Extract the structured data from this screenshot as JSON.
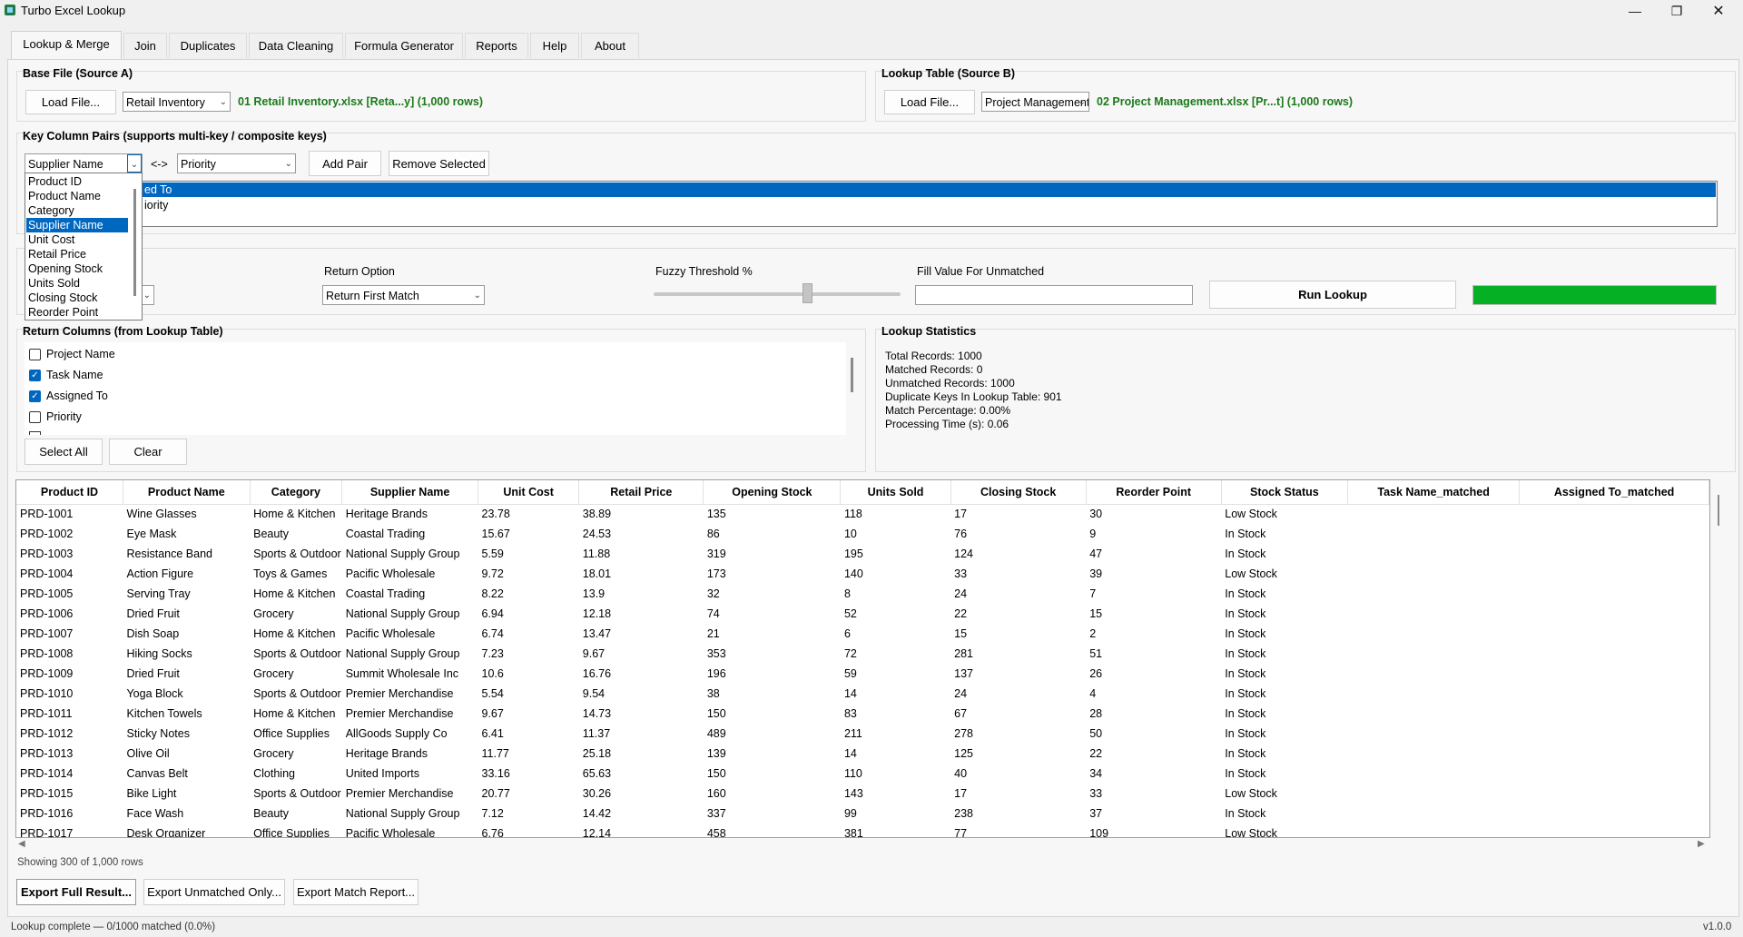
{
  "window": {
    "title": "Turbo Excel Lookup"
  },
  "tabs": [
    {
      "label": "Lookup & Merge"
    },
    {
      "label": "Join"
    },
    {
      "label": "Duplicates"
    },
    {
      "label": "Data Cleaning"
    },
    {
      "label": "Formula Generator"
    },
    {
      "label": "Reports"
    },
    {
      "label": "Help"
    },
    {
      "label": "About"
    }
  ],
  "base_file": {
    "title": "Base File (Source A)",
    "load_label": "Load File...",
    "sheet": "Retail Inventory",
    "info": "01 Retail Inventory.xlsx  [Reta...y]  (1,000 rows)"
  },
  "lookup_table": {
    "title": "Lookup Table (Source B)",
    "load_label": "Load File...",
    "sheet": "Project Management",
    "info": "02 Project Management.xlsx  [Pr...t]  (1,000 rows)"
  },
  "key_pairs": {
    "title": "Key Column Pairs  (supports multi-key / composite keys)",
    "left_value": "Supplier Name",
    "arrow": "<->",
    "right_value": "Priority",
    "add_label": "Add Pair",
    "remove_label": "Remove Selected",
    "list_items": [
      "ed To",
      "iority"
    ]
  },
  "dropdown_options": [
    "Product ID",
    "Product Name",
    "Category",
    "Supplier Name",
    "Unit Cost",
    "Retail Price",
    "Opening Stock",
    "Units Sold",
    "Closing Stock",
    "Reorder Point"
  ],
  "options": {
    "return_option_label": "Return Option",
    "return_option_value": "Return First Match",
    "fuzzy_label": "Fuzzy Threshold %",
    "fuzzy_value": 0.62,
    "fill_label": "Fill Value For Unmatched",
    "fill_value": "",
    "run_label": "Run Lookup",
    "progress": 1.0
  },
  "return_columns": {
    "title": "Return Columns (from Lookup Table)",
    "items": [
      {
        "label": "Project Name",
        "checked": false
      },
      {
        "label": "Task Name",
        "checked": true
      },
      {
        "label": "Assigned To",
        "checked": true
      },
      {
        "label": "Priority",
        "checked": false
      }
    ],
    "select_all_label": "Select All",
    "clear_label": "Clear"
  },
  "stats": {
    "title": "Lookup Statistics",
    "lines": [
      "Total Records: 1000",
      "Matched Records: 0",
      "Unmatched Records: 1000",
      "Duplicate Keys In Lookup Table: 901",
      "Match Percentage: 0.00%",
      "Processing Time (s): 0.06"
    ]
  },
  "grid": {
    "columns": [
      "Product ID",
      "Product Name",
      "Category",
      "Supplier Name",
      "Unit Cost",
      "Retail Price",
      "Opening Stock",
      "Units Sold",
      "Closing Stock",
      "Reorder Point",
      "Stock Status",
      "Task Name_matched",
      "Assigned To_matched"
    ],
    "rows": [
      [
        "PRD-1001",
        "Wine Glasses",
        "Home & Kitchen",
        "Heritage Brands",
        "23.78",
        "38.89",
        "135",
        "118",
        "17",
        "30",
        "Low Stock",
        "",
        ""
      ],
      [
        "PRD-1002",
        "Eye Mask",
        "Beauty",
        "Coastal Trading",
        "15.67",
        "24.53",
        "86",
        "10",
        "76",
        "9",
        "In Stock",
        "",
        ""
      ],
      [
        "PRD-1003",
        "Resistance Band",
        "Sports & Outdoor",
        "National Supply Group",
        "5.59",
        "11.88",
        "319",
        "195",
        "124",
        "47",
        "In Stock",
        "",
        ""
      ],
      [
        "PRD-1004",
        "Action Figure",
        "Toys & Games",
        "Pacific Wholesale",
        "9.72",
        "18.01",
        "173",
        "140",
        "33",
        "39",
        "Low Stock",
        "",
        ""
      ],
      [
        "PRD-1005",
        "Serving Tray",
        "Home & Kitchen",
        "Coastal Trading",
        "8.22",
        "13.9",
        "32",
        "8",
        "24",
        "7",
        "In Stock",
        "",
        ""
      ],
      [
        "PRD-1006",
        "Dried Fruit",
        "Grocery",
        "National Supply Group",
        "6.94",
        "12.18",
        "74",
        "52",
        "22",
        "15",
        "In Stock",
        "",
        ""
      ],
      [
        "PRD-1007",
        "Dish Soap",
        "Home & Kitchen",
        "Pacific Wholesale",
        "6.74",
        "13.47",
        "21",
        "6",
        "15",
        "2",
        "In Stock",
        "",
        ""
      ],
      [
        "PRD-1008",
        "Hiking Socks",
        "Sports & Outdoor",
        "National Supply Group",
        "7.23",
        "9.67",
        "353",
        "72",
        "281",
        "51",
        "In Stock",
        "",
        ""
      ],
      [
        "PRD-1009",
        "Dried Fruit",
        "Grocery",
        "Summit Wholesale Inc",
        "10.6",
        "16.76",
        "196",
        "59",
        "137",
        "26",
        "In Stock",
        "",
        ""
      ],
      [
        "PRD-1010",
        "Yoga Block",
        "Sports & Outdoor",
        "Premier Merchandise",
        "5.54",
        "9.54",
        "38",
        "14",
        "24",
        "4",
        "In Stock",
        "",
        ""
      ],
      [
        "PRD-1011",
        "Kitchen Towels",
        "Home & Kitchen",
        "Premier Merchandise",
        "9.67",
        "14.73",
        "150",
        "83",
        "67",
        "28",
        "In Stock",
        "",
        ""
      ],
      [
        "PRD-1012",
        "Sticky Notes",
        "Office Supplies",
        "AllGoods Supply Co",
        "6.41",
        "11.37",
        "489",
        "211",
        "278",
        "50",
        "In Stock",
        "",
        ""
      ],
      [
        "PRD-1013",
        "Olive Oil",
        "Grocery",
        "Heritage Brands",
        "11.77",
        "25.18",
        "139",
        "14",
        "125",
        "22",
        "In Stock",
        "",
        ""
      ],
      [
        "PRD-1014",
        "Canvas Belt",
        "Clothing",
        "United Imports",
        "33.16",
        "65.63",
        "150",
        "110",
        "40",
        "34",
        "In Stock",
        "",
        ""
      ],
      [
        "PRD-1015",
        "Bike Light",
        "Sports & Outdoor",
        "Premier Merchandise",
        "20.77",
        "30.26",
        "160",
        "143",
        "17",
        "33",
        "Low Stock",
        "",
        ""
      ],
      [
        "PRD-1016",
        "Face Wash",
        "Beauty",
        "National Supply Group",
        "7.12",
        "14.42",
        "337",
        "99",
        "238",
        "37",
        "In Stock",
        "",
        ""
      ],
      [
        "PRD-1017",
        "Desk Organizer",
        "Office Supplies",
        "Pacific Wholesale",
        "6.76",
        "12.14",
        "458",
        "381",
        "77",
        "109",
        "Low Stock",
        "",
        ""
      ]
    ],
    "showing": "Showing 300 of 1,000 rows"
  },
  "exports": {
    "full_label": "Export Full Result...",
    "unmatched_label": "Export Unmatched Only...",
    "report_label": "Export Match Report..."
  },
  "statusbar": {
    "text": "Lookup complete — 0/1000 matched (0.0%)",
    "version": "v1.0.0"
  },
  "colors": {
    "accent": "#0067c0",
    "success_text": "#1a7a1a",
    "progress": "#06b025"
  }
}
